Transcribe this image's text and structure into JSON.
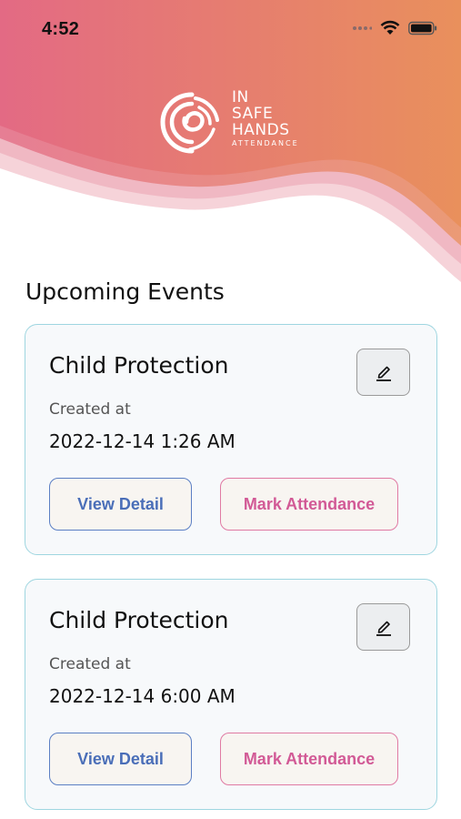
{
  "status_bar": {
    "time": "4:52"
  },
  "logo": {
    "line1": "IN",
    "line2": "SAFE",
    "line3": "HANDS",
    "line4": "ATTENDANCE"
  },
  "section": {
    "title": "Upcoming Events"
  },
  "events": [
    {
      "title": "Child Protection",
      "created_label": "Created at",
      "created_at": "2022-12-14 1:26 AM",
      "view_label": "View Detail",
      "attend_label": "Mark Attendance"
    },
    {
      "title": "Child Protection",
      "created_label": "Created at",
      "created_at": "2022-12-14 6:00 AM",
      "view_label": "View Detail",
      "attend_label": "Mark Attendance"
    }
  ],
  "colors": {
    "header_start": "#e36a84",
    "header_end": "#e9905c",
    "card_border": "#9fd6e0",
    "view_detail": "#4a6eb8",
    "mark_attendance": "#d25a96"
  },
  "icons": {
    "edit": "pencil-edit-icon",
    "wifi": "wifi-icon",
    "battery": "battery-icon",
    "signal": "cellular-signal-icon"
  }
}
